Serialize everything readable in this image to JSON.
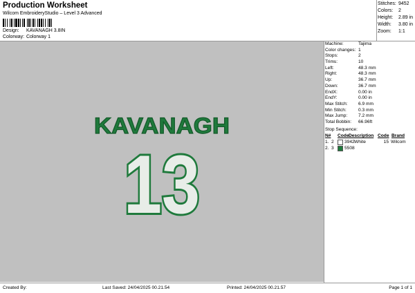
{
  "header": {
    "title": "Production Worksheet",
    "software": "Wilcom EmbroideryStudio – Level 3 Advanced",
    "design_label": "Design:",
    "design_value": "KAVANAGH 3.8IN",
    "colorway_label": "Colorway:",
    "colorway_value": "Colorway 1"
  },
  "stats": [
    {
      "label": "Stitches:",
      "value": "9452"
    },
    {
      "label": "Colors:",
      "value": "2"
    },
    {
      "label": "Height:",
      "value": "2.89 in"
    },
    {
      "label": "Width:",
      "value": "3.80 in"
    },
    {
      "label": "Zoom:",
      "value": "1:1"
    }
  ],
  "design": {
    "name_text": "KAVANAGH",
    "number_text": "13",
    "colors": {
      "green": "#1f7a3c",
      "white": "#e8ede8",
      "background": "#c0c0c0"
    }
  },
  "specs": [
    {
      "label": "Machine:",
      "value": "Tajima"
    },
    {
      "label": "Color changes:",
      "value": "1"
    },
    {
      "label": "Stops:",
      "value": "2"
    },
    {
      "label": "Trims:",
      "value": "10"
    },
    {
      "label": "Left:",
      "value": "48.3 mm"
    },
    {
      "label": "Right:",
      "value": "48.3 mm"
    },
    {
      "label": "Up:",
      "value": "36.7 mm"
    },
    {
      "label": "Down:",
      "value": "36.7 mm"
    },
    {
      "label": "EndX:",
      "value": "0.00 in"
    },
    {
      "label": "EndY:",
      "value": "0.00 in"
    },
    {
      "label": "Max Stitch:",
      "value": "6.9 mm"
    },
    {
      "label": "Min Stitch:",
      "value": "0.3 mm"
    },
    {
      "label": "Max Jump:",
      "value": "7.2 mm"
    },
    {
      "label": "Total Bobbin:",
      "value": "66.96ft"
    }
  ],
  "stop_sequence": {
    "title": "Stop Sequence:",
    "columns": [
      "N#",
      "Code",
      "Description",
      "Code",
      "Brand"
    ],
    "rows": [
      {
        "stop": "1.",
        "num": "2",
        "code": "3942",
        "description": "White",
        "code2": "15",
        "brand": "Wilcom",
        "swatch": "#ffffff"
      },
      {
        "stop": "2.",
        "num": "3",
        "code": "5508",
        "description": "",
        "code2": "",
        "brand": "",
        "swatch": "#1f7a3c"
      }
    ]
  },
  "footer": {
    "created_by": "Created By:",
    "last_saved": "Last Saved: 24/04/2025 00.21.54",
    "printed": "Printed: 24/04/2025 00.21.57",
    "page": "Page 1 of 1"
  }
}
